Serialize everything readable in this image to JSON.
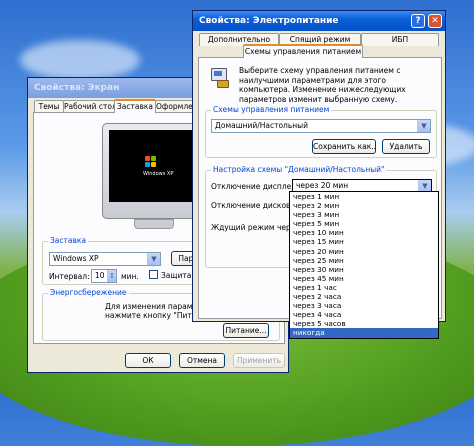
{
  "display_window": {
    "title": "Свойства: Экран",
    "tabs": [
      "Темы",
      "Рабочий стол",
      "Заставка",
      "Оформлен"
    ],
    "active_tab": "Заставка",
    "preview_os_text": "Windows XP",
    "screensaver_group": "Заставка",
    "screensaver_value": "Windows XP",
    "params_button": "Парам",
    "interval_label": "Интервал:",
    "interval_value": "10",
    "interval_unit": "мин.",
    "password_label": "Защита па",
    "energy_group": "Энергосбережение",
    "energy_text": "Для изменения параметр нажмите кнопку \"Питани",
    "power_button": "Питание...",
    "ok_button": "ОК",
    "cancel_button": "Отмена",
    "apply_button": "Применить"
  },
  "power_window": {
    "title": "Свойства: Электропитание",
    "help_btn": "?",
    "close_btn": "✕",
    "tabs_row1": [
      "Дополнительно",
      "Спящий режим",
      "ИБП"
    ],
    "tab_active": "Схемы управления питанием",
    "intro_text": "Выберите схему управления питанием с наилучшими параметрами для этого компьютера. Изменение нижеследующих параметров изменит выбранную схему.",
    "schemes_group": "Схемы управления питанием",
    "scheme_value": "Домашний/Настольный",
    "save_as_button": "Сохранить как...",
    "delete_button": "Удалить",
    "settings_group": "Настройка схемы \"Домашний/Настольный\"",
    "display_off_label": "Отключение дисплея:",
    "display_off_value": "через 20 мин",
    "disks_off_label": "Отключение дисков:",
    "standby_label": "Ждущий режим через",
    "dropdown_options": [
      "через 1 мин",
      "через 2 мин",
      "через 3 мин",
      "через 5 мин",
      "через 10 мин",
      "через 15 мин",
      "через 20 мин",
      "через 25 мин",
      "через 30 мин",
      "через 45 мин",
      "через 1 час",
      "через 2 часа",
      "через 3 часа",
      "через 4 часа",
      "через 5 часов",
      "никогда"
    ],
    "highlighted_option": "никогда"
  },
  "colors": {
    "titlebar_active": "#0551c7",
    "selection": "#316ac5",
    "group_label": "#0046d5",
    "tab_highlight": "#e68b2c"
  },
  "icons": {
    "power_scheme": "power-plug-monitor-icon",
    "dropdown_arrow": "chevron-down-icon",
    "windows_logo": "windows-flag-icon"
  }
}
